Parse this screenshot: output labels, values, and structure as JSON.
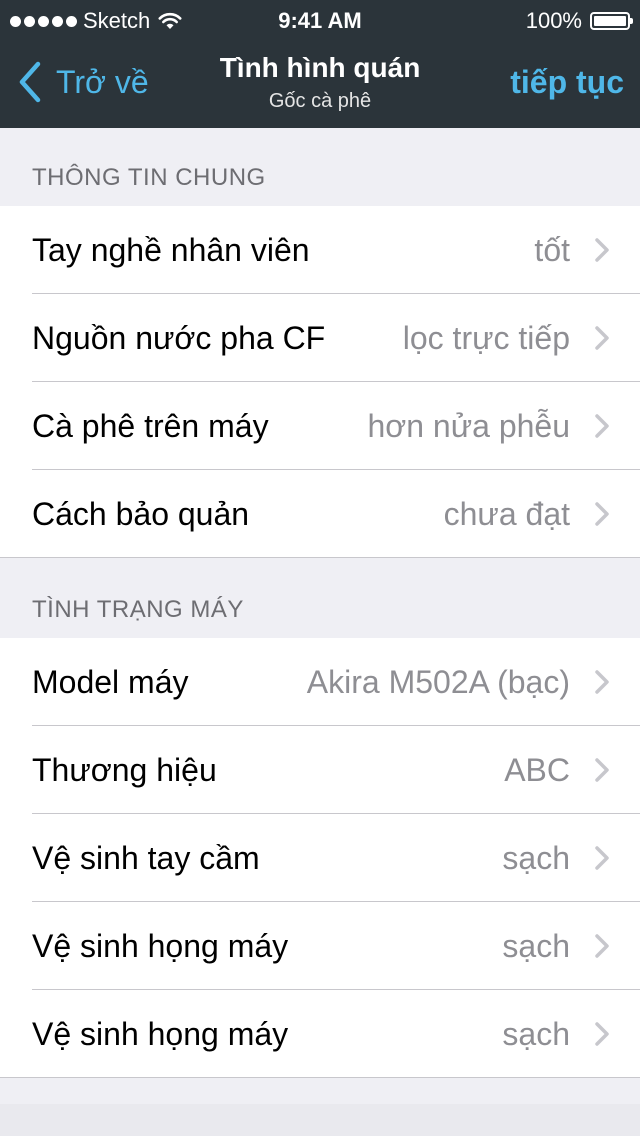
{
  "status_bar": {
    "carrier": "Sketch",
    "time": "9:41 AM",
    "battery": "100%"
  },
  "nav": {
    "back_label": "Trở về",
    "title": "Tình hình quán",
    "subtitle": "Gốc cà phê",
    "next_label": "tiếp tục"
  },
  "sections": [
    {
      "header": "THÔNG TIN CHUNG",
      "rows": [
        {
          "label": "Tay nghề nhân viên",
          "value": "tốt"
        },
        {
          "label": "Nguồn nước pha CF",
          "value": "lọc trực tiếp"
        },
        {
          "label": "Cà phê trên máy",
          "value": "hơn nửa phễu"
        },
        {
          "label": "Cách bảo quản",
          "value": "chưa đạt"
        }
      ]
    },
    {
      "header": "TÌNH TRẠNG MÁY",
      "rows": [
        {
          "label": "Model máy",
          "value": "Akira M502A (bạc)"
        },
        {
          "label": "Thương hiệu",
          "value": "ABC"
        },
        {
          "label": "Vệ sinh tay cầm",
          "value": "sạch"
        },
        {
          "label": "Vệ sinh họng máy",
          "value": "sạch"
        },
        {
          "label": "Vệ sinh họng máy",
          "value": "sạch"
        }
      ]
    }
  ],
  "colors": {
    "nav_background": "#2b343a",
    "accent": "#4fb7e8",
    "page_background": "#efeff4"
  }
}
